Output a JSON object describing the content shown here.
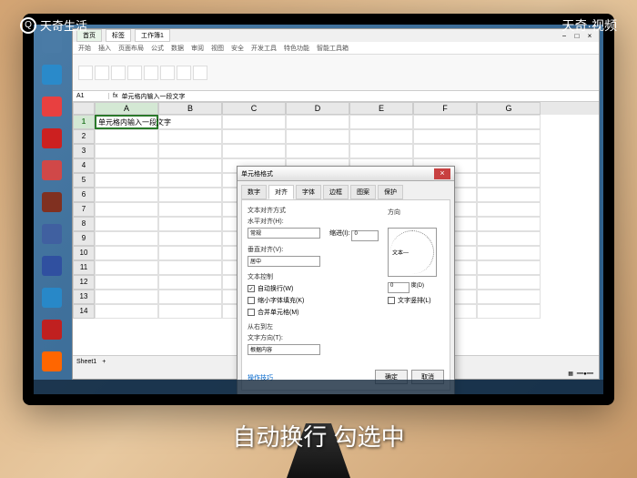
{
  "watermarks": {
    "top_left": "天奇生活",
    "top_right": "天奇·视频"
  },
  "subtitle": "自动换行 勾选中",
  "excel": {
    "tabs": [
      "首页",
      "标签",
      "工作簿1"
    ],
    "ribbon_tabs": [
      "开始",
      "插入",
      "页面布局",
      "公式",
      "数据",
      "审阅",
      "视图",
      "安全",
      "开发工具",
      "特色功能",
      "智能工具箱"
    ],
    "cell_ref": "A1",
    "col_headers": [
      "A",
      "B",
      "C",
      "D",
      "E",
      "F",
      "G"
    ],
    "row_count": 14,
    "cell_a1": "单元格内输入一段文字",
    "sheet_name": "Sheet1"
  },
  "dialog": {
    "title": "单元格格式",
    "tabs": [
      "数字",
      "对齐",
      "字体",
      "边框",
      "图案",
      "保护"
    ],
    "active_tab": "对齐",
    "sections": {
      "text_align": "文本对齐方式",
      "horizontal": "水平对齐(H):",
      "horizontal_val": "常规",
      "indent": "缩进(I):",
      "indent_val": "0",
      "vertical": "垂直对齐(V):",
      "vertical_val": "居中",
      "text_control": "文本控制",
      "wrap": "自动换行(W)",
      "shrink": "缩小字体填充(K)",
      "merge": "合并单元格(M)",
      "rtl": "从右到左",
      "direction": "文字方向(T):",
      "direction_val": "根据内容",
      "orientation": "方向",
      "orient_text": "文本—",
      "degrees": "度(D)",
      "text_vert": "文字竖排(L)"
    },
    "help": "操作技巧",
    "ok": "确定",
    "cancel": "取消"
  },
  "desktop_icons": [
    {
      "color": "#4a7ba6"
    },
    {
      "color": "#2a8aca"
    },
    {
      "color": "#e84040"
    },
    {
      "color": "#cc2020"
    },
    {
      "color": "#d04848"
    },
    {
      "color": "#803020"
    },
    {
      "color": "#4060a0"
    },
    {
      "color": "#3050a0"
    },
    {
      "color": "#2888c8"
    },
    {
      "color": "#c02020"
    },
    {
      "color": "#ff6600"
    }
  ]
}
